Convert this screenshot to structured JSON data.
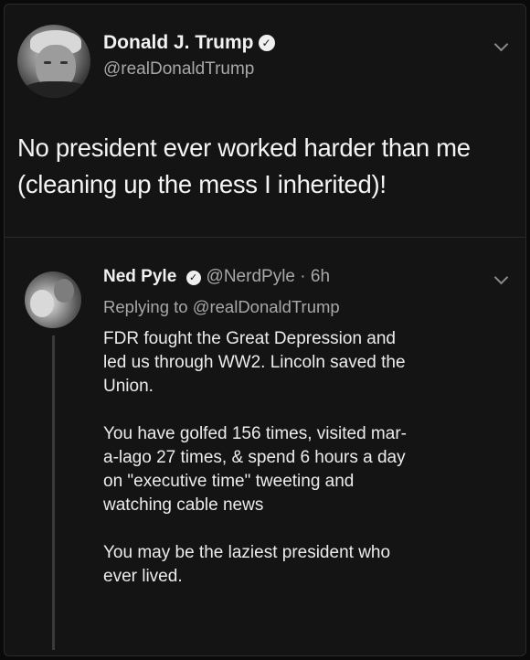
{
  "main_tweet": {
    "author_name": "Donald J. Trump",
    "verified_glyph": "✓",
    "handle": "@realDonaldTrump",
    "text": "No president ever worked harder than me (cleaning up the mess I inherited)!",
    "avatar_icon": "profile-photo-icon",
    "menu_icon": "chevron-down-icon"
  },
  "reply_tweet": {
    "author_name": "Ned Pyle",
    "verified_glyph": "✓",
    "handle": "@NerdPyle",
    "time": "· 6h",
    "replying_to": "Replying to @realDonaldTrump",
    "paragraphs": [
      "FDR fought the Great Depression  and\nled us through WW2. Lincoln saved the\nUnion.",
      "You have golfed 156 times, visited mar-\na-lago 27 times, & spend 6 hours a day\non \"executive time\" tweeting and\nwatching cable news",
      "You may be the laziest president who\never lived."
    ],
    "avatar_icon": "profile-photo-icon",
    "menu_icon": "chevron-down-icon"
  }
}
